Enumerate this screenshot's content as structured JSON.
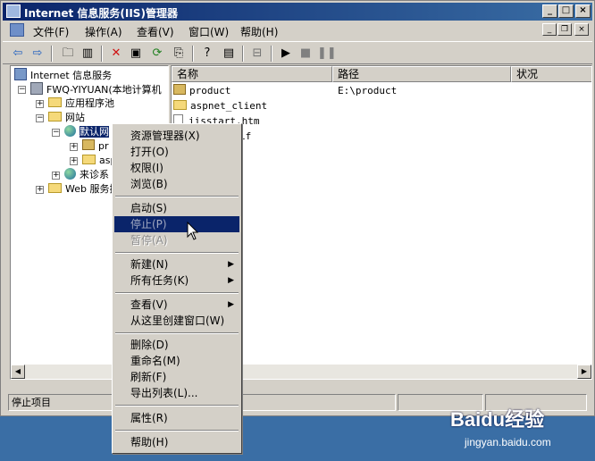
{
  "window": {
    "title": "Internet 信息服务(IIS)管理器",
    "buttons": {
      "minimize": "_",
      "maximize": "□",
      "close": "×"
    }
  },
  "menubar": {
    "items": [
      "文件(F)",
      "操作(A)",
      "查看(V)",
      "窗口(W)",
      "帮助(H)"
    ],
    "mdi_buttons": {
      "minimize": "_",
      "restore": "❐",
      "close": "×"
    }
  },
  "toolbar": {
    "icons": [
      "back-arrow-icon",
      "forward-arrow-icon",
      "up-folder-icon",
      "show-tree-icon",
      "delete-icon",
      "properties-icon",
      "refresh-icon",
      "export-icon",
      "help-icon",
      "console-icon",
      "computer-icon",
      "play-icon",
      "stop-icon",
      "pause-icon"
    ]
  },
  "tree": {
    "root": "Internet 信息服务",
    "server": "FWQ-YIYUAN(本地计算机",
    "app_pools": "应用程序池",
    "websites": "网站",
    "default_site": "默认网",
    "child_pr": "pr",
    "child_asp": "asp",
    "site2": "来诊系",
    "web_ext": "Web 服务扩"
  },
  "list": {
    "columns": [
      "名称",
      "路径",
      "状况"
    ],
    "rows": [
      {
        "name": "product",
        "path": "E:\\product",
        "icon": "package-icon"
      },
      {
        "name": "aspnet_client",
        "path": "",
        "icon": "folder-icon"
      },
      {
        "name": "iisstart.htm",
        "path": "",
        "icon": "file-icon"
      },
      {
        "name": "if",
        "path": "",
        "icon": "file-icon"
      }
    ]
  },
  "status": {
    "text": "停止项目"
  },
  "context_menu": {
    "items": [
      {
        "label": "资源管理器(X)"
      },
      {
        "label": "打开(O)"
      },
      {
        "label": "权限(I)"
      },
      {
        "label": "浏览(B)"
      },
      {
        "label": "启动(S)"
      },
      {
        "label": "停止(P)"
      },
      {
        "label": "暂停(A)"
      },
      {
        "label": "新建(N)"
      },
      {
        "label": "所有任务(K)"
      },
      {
        "label": "查看(V)"
      },
      {
        "label": "从这里创建窗口(W)"
      },
      {
        "label": "删除(D)"
      },
      {
        "label": "重命名(M)"
      },
      {
        "label": "刷新(F)"
      },
      {
        "label": "导出列表(L)..."
      },
      {
        "label": "属性(R)"
      },
      {
        "label": "帮助(H)"
      }
    ]
  },
  "watermark": {
    "logo": "Baidu经验",
    "url": "jingyan.baidu.com"
  }
}
